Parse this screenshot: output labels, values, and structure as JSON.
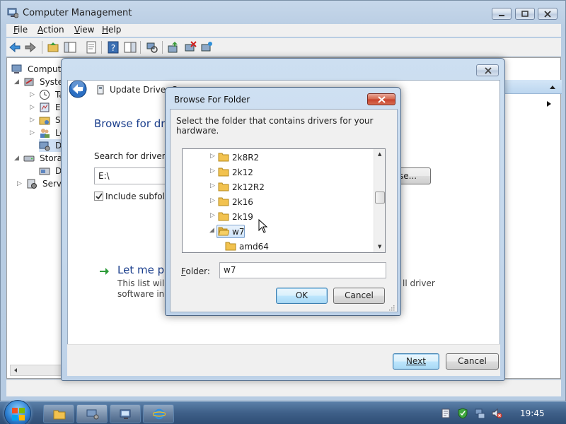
{
  "main": {
    "title": "Computer Management",
    "menu": [
      "File",
      "Action",
      "View",
      "Help"
    ],
    "menu_accel": [
      "F",
      "A",
      "V",
      "H"
    ],
    "tree": [
      {
        "label": "Compute"
      },
      {
        "label": "Systen"
      },
      {
        "label": "Ta"
      },
      {
        "label": "Ev"
      },
      {
        "label": "Sh"
      },
      {
        "label": "Lo"
      },
      {
        "label": "De"
      },
      {
        "label": "Storag"
      },
      {
        "label": "Di"
      },
      {
        "label": "Servic"
      }
    ]
  },
  "wizard": {
    "title": "Update Driver So",
    "heading": "Browse for driv",
    "search_label": "Search for driver so",
    "path_value": "E:\\",
    "browse_label": "se...",
    "include_subfolders": "Include subfolde",
    "include_checked": true,
    "letme_label": "Let me pic",
    "desc_line1": "This list will s",
    "desc_line2": "software in th",
    "desc_tail": "ll driver",
    "next_label": "Next",
    "cancel_label": "Cancel"
  },
  "browse": {
    "title": "Browse For Folder",
    "description": "Select the folder that contains drivers for your hardware.",
    "folders": [
      {
        "label": "2k8R2",
        "expanded": false,
        "selected": false
      },
      {
        "label": "2k12",
        "expanded": false,
        "selected": false
      },
      {
        "label": "2k12R2",
        "expanded": false,
        "selected": false
      },
      {
        "label": "2k16",
        "expanded": false,
        "selected": false
      },
      {
        "label": "2k19",
        "expanded": false,
        "selected": false
      },
      {
        "label": "w7",
        "expanded": true,
        "selected": true
      },
      {
        "label": "amd64",
        "expanded": false,
        "selected": false
      }
    ],
    "folder_label": "Folder:",
    "folder_value": "w7",
    "ok_label": "OK",
    "cancel_label": "Cancel"
  },
  "taskbar": {
    "clock": "19:45"
  },
  "colors": {
    "accent_blue": "#1a3e8c",
    "folder_yellow": "#f2c24f",
    "close_red": "#c7402a"
  }
}
